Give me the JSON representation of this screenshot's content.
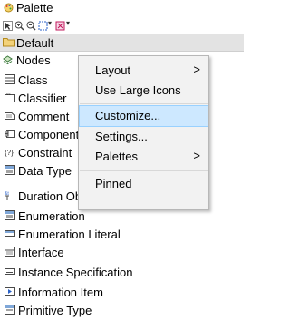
{
  "palette": {
    "title": "Palette"
  },
  "drawer": {
    "label": "Default"
  },
  "nodes": {
    "label": "Nodes"
  },
  "items": [
    "Class",
    "Classifier",
    "Comment",
    "Component",
    "Constraint",
    "Data Type",
    "Duration Observation",
    "Enumeration",
    "Enumeration Literal",
    "Interface",
    "Instance Specification",
    "Information Item",
    "Primitive Type"
  ],
  "context_menu": {
    "items": [
      "Layout",
      "Use Large Icons",
      "Customize...",
      "Settings...",
      "Palettes",
      "Pinned"
    ],
    "highlighted": "Customize..."
  },
  "colors": {
    "menu_highlight": "#cde8ff",
    "drawer_bg": "#e3e3e3"
  }
}
